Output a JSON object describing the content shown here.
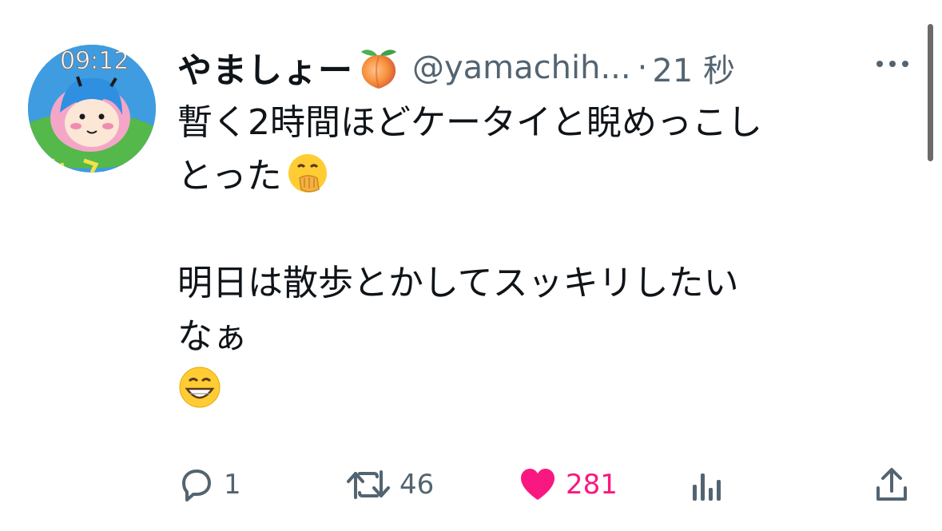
{
  "tweet": {
    "display_name": "やましょー",
    "name_emoji": "peach-emoji",
    "handle": "@yamachih...",
    "separator": "·",
    "time_ago": "21 秒",
    "body_lines": [
      "暫く2時間ほどケータイと睨めっこし",
      "とった",
      "明日は散歩とかしてスッキリしたい",
      "なぁ"
    ],
    "body_emojis": [
      "face-with-hand-over-mouth-emoji",
      "grinning-face-emoji"
    ],
    "avatar": {
      "clock_text": "09:12"
    }
  },
  "actions": {
    "reply_count": "1",
    "retweet_count": "46",
    "like_count": "281"
  },
  "colors": {
    "text": "#0f1419",
    "muted": "#536471",
    "like": "#f91880",
    "avatar_bg": "#3f9ce0"
  }
}
